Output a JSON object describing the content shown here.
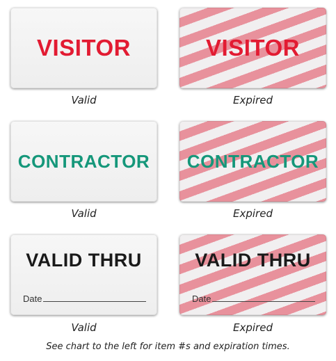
{
  "badges": [
    {
      "text": "VISITOR",
      "caption": "Valid"
    },
    {
      "text": "VISITOR",
      "caption": "Expired"
    },
    {
      "text": "CONTRACTOR",
      "caption": "Valid"
    },
    {
      "text": "CONTRACTOR",
      "caption": "Expired"
    },
    {
      "text": "VALID THRU",
      "date_label": "Date",
      "caption": "Valid"
    },
    {
      "text": "VALID THRU",
      "date_label": "Date",
      "caption": "Expired"
    }
  ],
  "footer": "See chart to the left for item #s and expiration times.",
  "colors": {
    "visitor_red": "#e21b32",
    "contractor_green": "#15977a",
    "expired_stripe": "#e8919c"
  }
}
